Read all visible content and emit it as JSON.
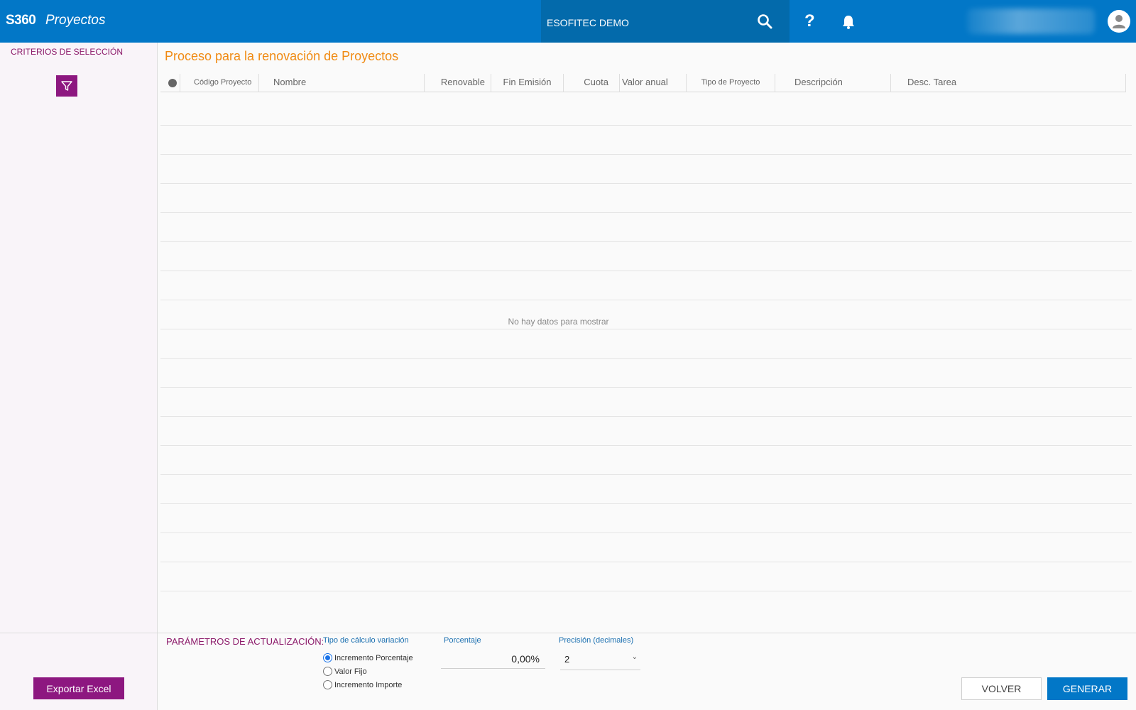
{
  "header": {
    "brand": "S360",
    "module": "Proyectos",
    "company": "ESOFITEC DEMO",
    "help_label": "?"
  },
  "sidebar": {
    "criteria_label": "CRITERIOS DE SELECCIÓN",
    "export_label": "Exportar Excel"
  },
  "main": {
    "title": "Proceso para la renovación de Proyectos",
    "columns": [
      "Código Proyecto",
      "Nombre",
      "Renovable",
      "Fin Emisión",
      "Cuota",
      "Valor anual",
      "Tipo de Proyecto",
      "Descripción",
      "Desc. Tarea"
    ],
    "empty_message": "No hay datos para mostrar"
  },
  "params": {
    "title": "PARÁMETROS DE ACTUALIZACIÓN:",
    "calc_type_label": "Tipo de cálculo variación",
    "options": [
      "Incremento Porcentaje",
      "Valor Fijo",
      "Incremento Importe"
    ],
    "selected_option": "Incremento Porcentaje",
    "percentage_label": "Porcentaje",
    "percentage_value": "0,00%",
    "precision_label": "Precisión (decimales)",
    "precision_value": "2"
  },
  "actions": {
    "back_label": "VOLVER",
    "generate_label": "GENERAR"
  },
  "colors": {
    "primary": "#0277c7",
    "accent": "#8d1780",
    "title": "#f08a12"
  }
}
